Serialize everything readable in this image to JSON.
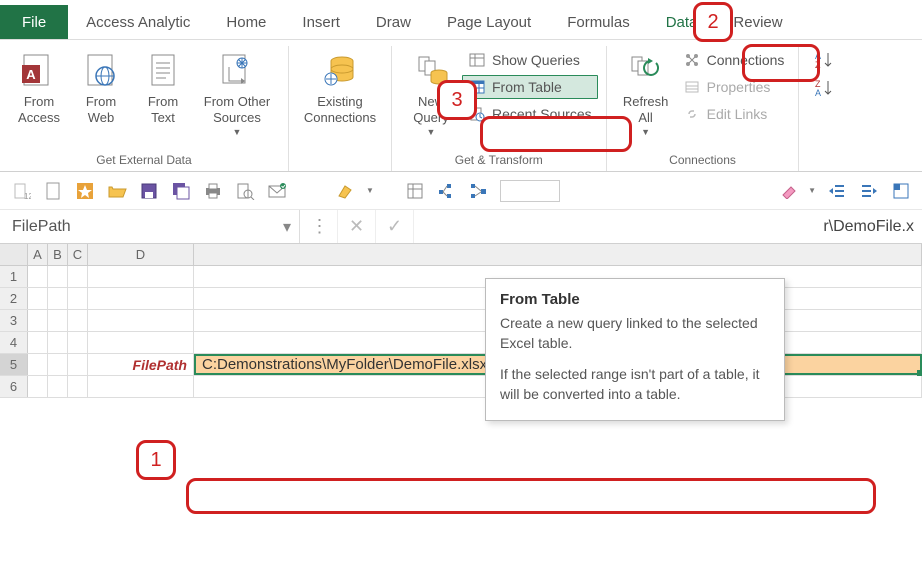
{
  "tabs": {
    "file": "File",
    "access_analytic": "Access Analytic",
    "home": "Home",
    "insert": "Insert",
    "draw": "Draw",
    "page_layout": "Page Layout",
    "formulas": "Formulas",
    "data": "Data",
    "review": "Review"
  },
  "ribbon": {
    "get_external": {
      "label": "Get External Data",
      "from_access": "From\nAccess",
      "from_web": "From\nWeb",
      "from_text": "From\nText",
      "from_other": "From Other\nSources"
    },
    "existing_connections": "Existing\nConnections",
    "get_transform": {
      "label": "Get & Transform",
      "new_query": "New\nQuery",
      "show_queries": "Show Queries",
      "from_table": "From Table",
      "recent_sources": "Recent Sources"
    },
    "connections_group": {
      "label": "Connections",
      "refresh_all": "Refresh\nAll",
      "connections": "Connections",
      "properties": "Properties",
      "edit_links": "Edit Links"
    }
  },
  "name_box": "FilePath",
  "formula_bar_trunc": "r\\DemoFile.x",
  "columns": {
    "a": "A",
    "b": "B",
    "c": "C",
    "d": "D"
  },
  "row_numbers": [
    "1",
    "2",
    "3",
    "4",
    "5",
    "6"
  ],
  "cell_d5_label": "FilePath",
  "cell_e5_value": "C:Demonstrations\\MyFolder\\DemoFile.xlsx",
  "tooltip": {
    "title": "From Table",
    "p1": "Create a new query linked to the selected Excel table.",
    "p2": "If the selected range isn't part of a table, it will be converted into a table."
  },
  "annotations": {
    "n1": "1",
    "n2": "2",
    "n3": "3"
  }
}
